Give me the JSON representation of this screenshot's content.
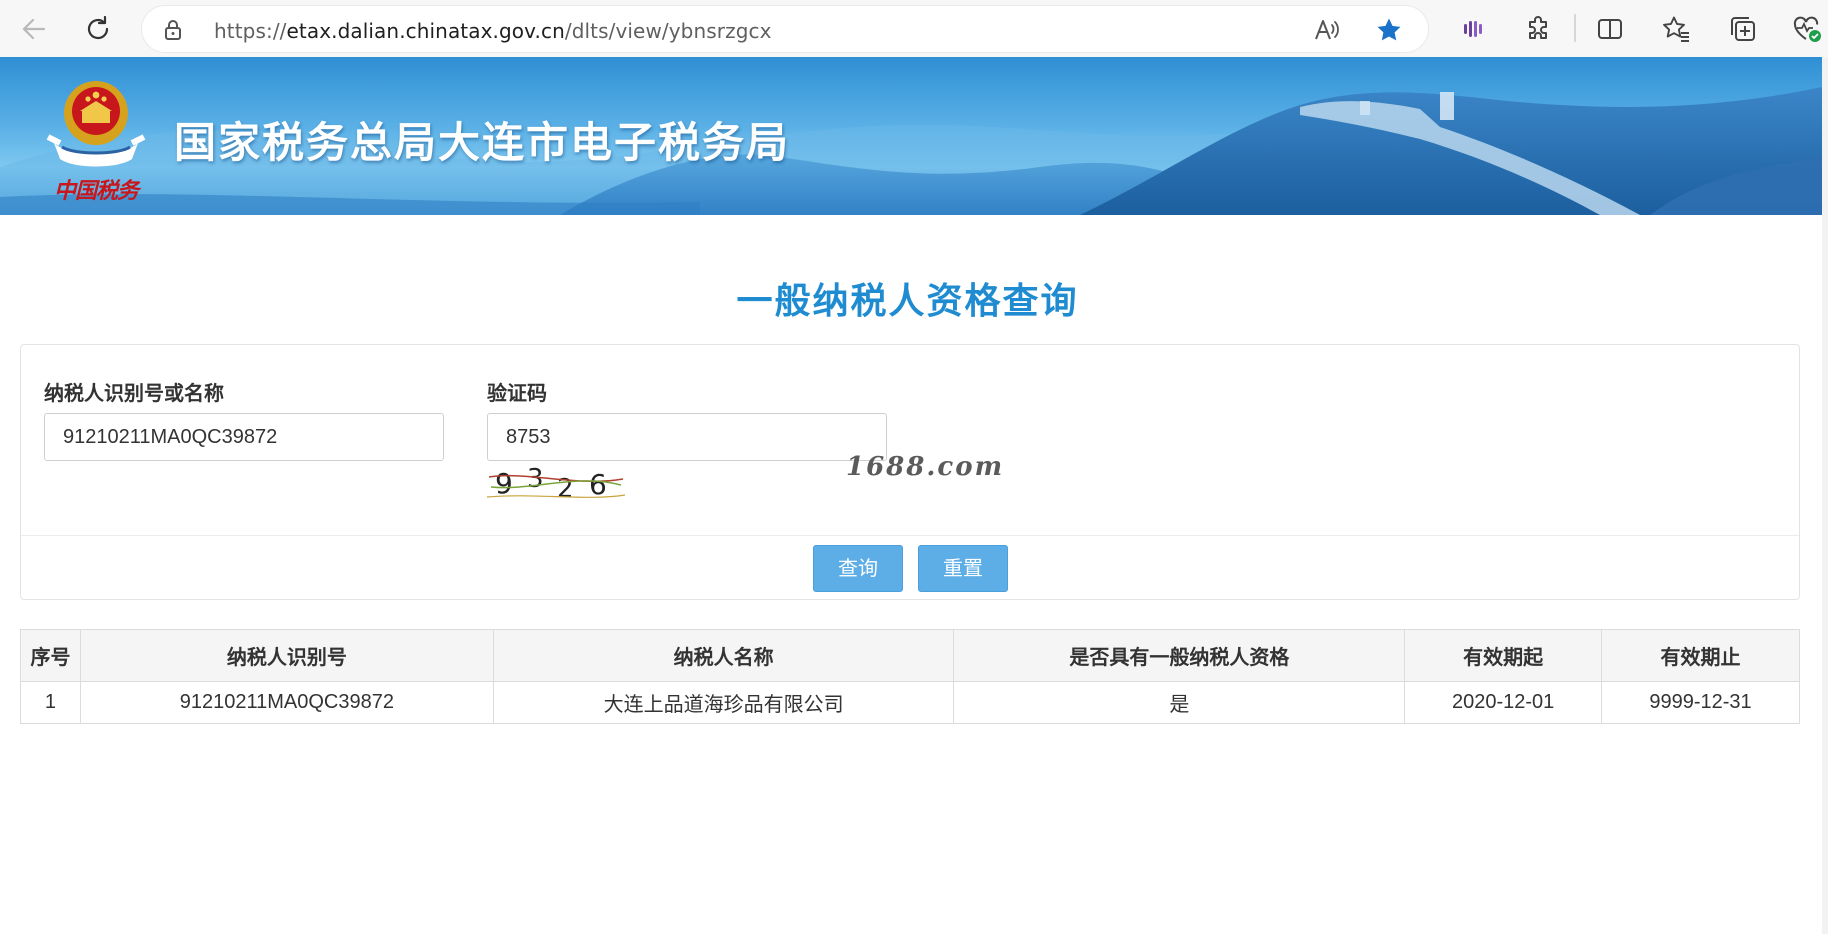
{
  "browser": {
    "url_prefix": "https://",
    "url_host": "etax.dalian.chinatax.gov.cn",
    "url_path": "/dlts/view/ybnsrzgcx"
  },
  "banner": {
    "title": "国家税务总局大连市电子税务局",
    "emblem_caption": "中国税务"
  },
  "page": {
    "title": "一般纳税人资格查询"
  },
  "form": {
    "taxpayer_label": "纳税人识别号或名称",
    "taxpayer_value": "91210211MA0QC39872",
    "captcha_label": "验证码",
    "captcha_value": "8753",
    "captcha_image_text": "9326",
    "query_button": "查询",
    "reset_button": "重置"
  },
  "watermark": "1688.com",
  "table": {
    "headers": [
      "序号",
      "纳税人识别号",
      "纳税人名称",
      "是否具有一般纳税人资格",
      "有效期起",
      "有效期止"
    ],
    "rows": [
      [
        "1",
        "91210211MA0QC39872",
        "大连上品道海珍品有限公司",
        "是",
        "2020-12-01",
        "9999-12-31"
      ]
    ]
  },
  "colors": {
    "accent": "#1f8cd1",
    "button": "#5dade7",
    "favorite_star": "#1a73c9"
  }
}
